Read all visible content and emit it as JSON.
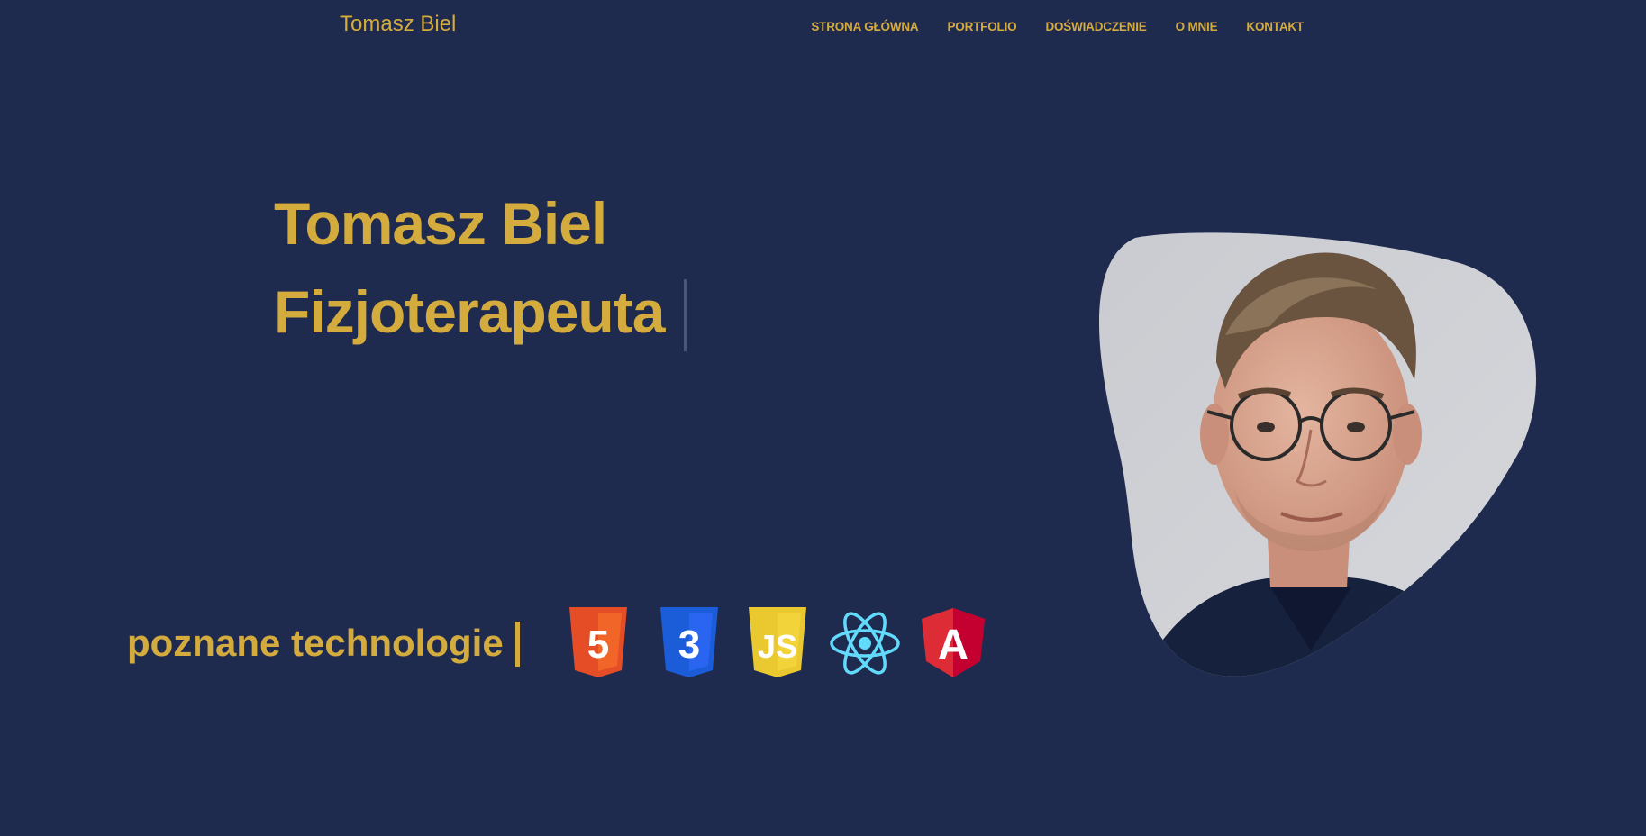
{
  "header": {
    "brand": "Tomasz Biel",
    "nav": [
      {
        "label": "STRONA GŁÓWNA"
      },
      {
        "label": "PORTFOLIO"
      },
      {
        "label": "DOŚWIADCZENIE"
      },
      {
        "label": "O MNIE"
      },
      {
        "label": "KONTAKT"
      }
    ]
  },
  "hero": {
    "name": "Tomasz Biel",
    "role": "Fizjoterapeuta"
  },
  "tech": {
    "label": "poznane technologie",
    "logos": [
      "html5-logo-icon",
      "css3-logo-icon",
      "js-logo-icon",
      "react-logo-icon",
      "angular-logo-icon"
    ],
    "html_digit": "5",
    "css_digit": "3",
    "js_text": "JS",
    "angular_letter": "A"
  },
  "colors": {
    "background": "#1f2a4f",
    "accent": "#d4ac3d",
    "html5": "#e44d26",
    "css3": "#1b5cd8",
    "js": "#e9c92f",
    "react": "#61dafb",
    "angular": "#dd2c36"
  },
  "photo": {
    "icon": "profile-photo"
  }
}
